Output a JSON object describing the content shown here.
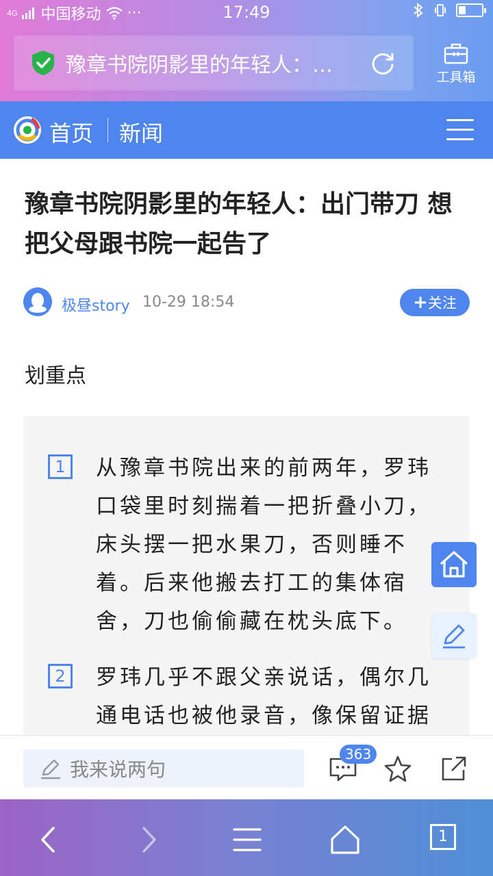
{
  "status_bar": {
    "carrier": "中国移动",
    "network": "4G",
    "extra": "···",
    "time": "17:49",
    "battery_level": 0.3
  },
  "browser": {
    "url_title": "豫章书院阴影里的年轻人：出门带刀 想把父母跟书院一起告了",
    "toolbox_label": "工具箱"
  },
  "site_nav": {
    "home_label": "首页",
    "section_label": "新闻"
  },
  "article": {
    "title": "豫章书院阴影里的年轻人：出门带刀 想把父母跟书院一起告了",
    "author": "极昼story",
    "time": "10-29 18:54",
    "follow_label": "关注",
    "section_label": "划重点",
    "highlights": [
      {
        "num": "1",
        "text": "从豫章书院出来的前两年，罗玮口袋里时刻揣着一把折叠小刀，床头摆一把水果刀，否则睡不着。后来他搬去打工的集体宿舍，刀也偷偷藏在枕头底下。"
      },
      {
        "num": "2",
        "text": "罗玮几乎不跟父亲说话，偶尔几通电话也被他录音，像保留证据"
      }
    ]
  },
  "comment_bar": {
    "placeholder": "我来说两句",
    "comment_count": "363"
  },
  "bottom_nav": {
    "tab_count": "1"
  },
  "colors": {
    "accent": "#4e86ee",
    "highlight_bg": "#f5f5f5"
  }
}
